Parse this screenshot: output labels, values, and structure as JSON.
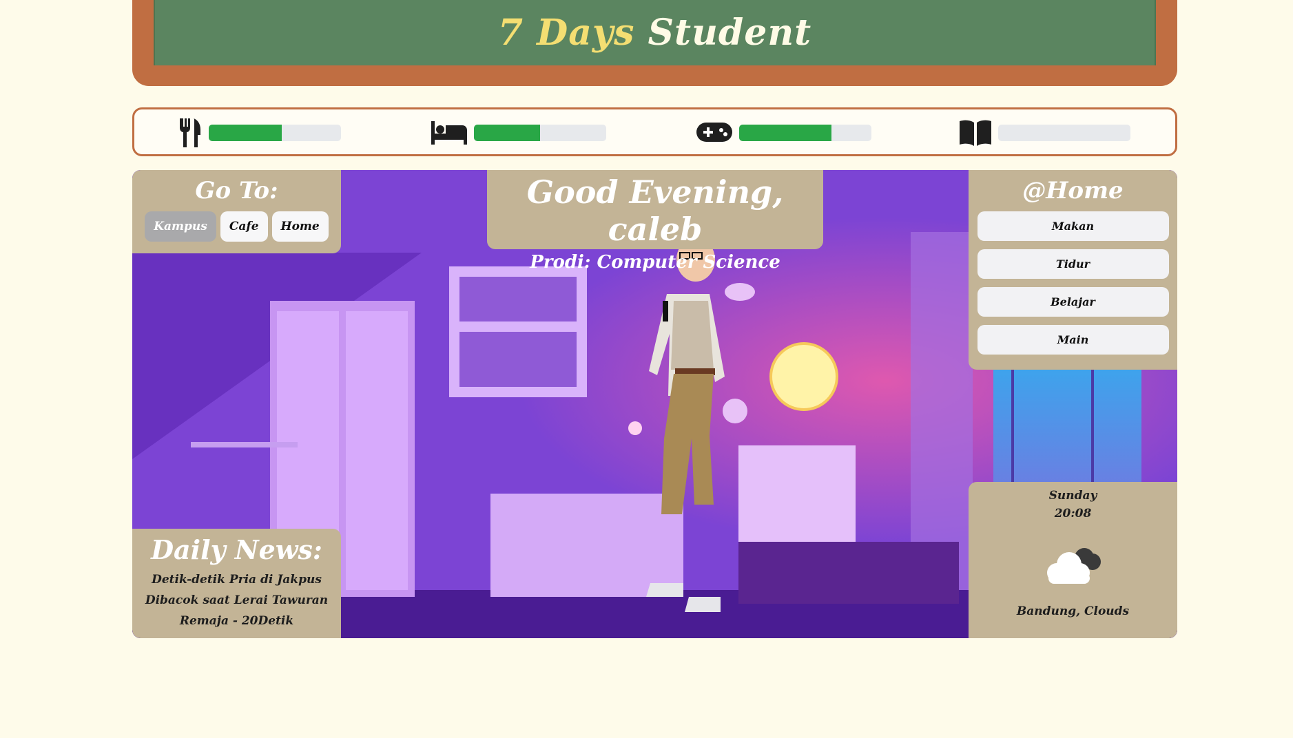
{
  "header": {
    "title_part1": "7 Days",
    "title_part2": "Student"
  },
  "stats": [
    {
      "name": "makan",
      "icon": "fork-knife-icon",
      "level": 0.55
    },
    {
      "name": "tidur",
      "icon": "bed-icon",
      "level": 0.5
    },
    {
      "name": "main",
      "icon": "gamepad-icon",
      "level": 0.7
    },
    {
      "name": "belajar",
      "icon": "book-icon",
      "level": 0.0
    }
  ],
  "goto": {
    "title": "Go To:",
    "buttons": [
      "Kampus",
      "Cafe",
      "Home"
    ]
  },
  "greeting": {
    "title": "Good Evening, caleb",
    "prodi": "Prodi: Computer Science"
  },
  "location": {
    "title": "@Home",
    "actions": [
      "Makan",
      "Tidur",
      "Belajar",
      "Main"
    ]
  },
  "news": {
    "title": "Daily News:",
    "headline": "Detik-detik Pria di Jakpus Dibacok saat Lerai Tawuran Remaja - 20Detik"
  },
  "weather": {
    "day": "Sunday",
    "time": "20:08",
    "location": "Bandung, Clouds",
    "icon": "clouds-icon"
  },
  "colors": {
    "background": "#fefbea",
    "frame": "#c06e42",
    "board": "#5b8560",
    "title_accent": "#f4de72",
    "panel": "#c3b496",
    "bar_fill": "#29a746",
    "bar_empty": "#e7e9ec"
  }
}
